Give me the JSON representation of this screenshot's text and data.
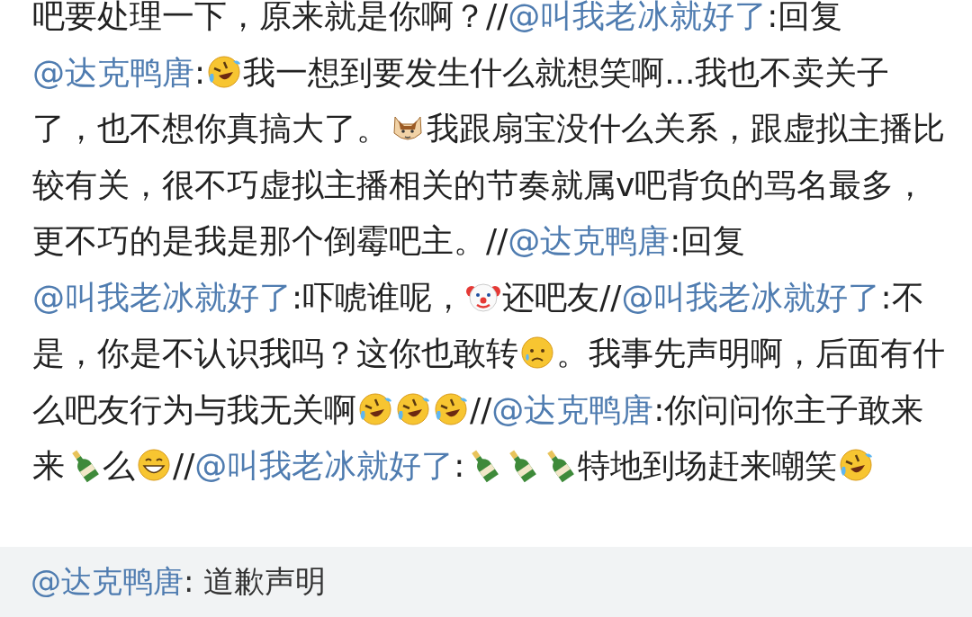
{
  "post": {
    "segments": [
      {
        "kind": "text",
        "text": "吧要处理一下，原来就是你啊？//"
      },
      {
        "kind": "mention",
        "text": "@叫我老冰就好了"
      },
      {
        "kind": "text",
        "text": ":回复"
      },
      {
        "kind": "mention",
        "text": "@达克鸭唐"
      },
      {
        "kind": "text",
        "text": ":"
      },
      {
        "kind": "laughing"
      },
      {
        "kind": "text",
        "text": "我一想到要发生什么就想笑啊...我也不卖关子了，也不想你真搞大了。"
      },
      {
        "kind": "cat"
      },
      {
        "kind": "text",
        "text": "我跟扇宝没什么关系，跟虚拟主播比较有关，很不巧虚拟主播相关的节奏就属v吧背负的骂名最多，更不巧的是我是那个倒霉吧主。//"
      },
      {
        "kind": "mention",
        "text": "@达克鸭唐"
      },
      {
        "kind": "text",
        "text": ":回复"
      },
      {
        "kind": "mention",
        "text": "@叫我老冰就好了"
      },
      {
        "kind": "text",
        "text": ":吓唬谁呢，"
      },
      {
        "kind": "clown"
      },
      {
        "kind": "text",
        "text": "还吧友//"
      },
      {
        "kind": "mention",
        "text": "@叫我老冰就好了"
      },
      {
        "kind": "text",
        "text": ":不是，你是不认识我吗？这你也敢转"
      },
      {
        "kind": "worried"
      },
      {
        "kind": "text",
        "text": "。我事先声明啊，后面有什么吧友行为与我无关啊"
      },
      {
        "kind": "laughing"
      },
      {
        "kind": "laughing"
      },
      {
        "kind": "laughing"
      },
      {
        "kind": "text",
        "text": "//"
      },
      {
        "kind": "mention",
        "text": "@达克鸭唐"
      },
      {
        "kind": "text",
        "text": ":你问问你主子敢来来"
      },
      {
        "kind": "champagne"
      },
      {
        "kind": "text",
        "text": "么"
      },
      {
        "kind": "grinning"
      },
      {
        "kind": "text",
        "text": "//"
      },
      {
        "kind": "mention",
        "text": "@叫我老冰就好了"
      },
      {
        "kind": "text",
        "text": ":"
      },
      {
        "kind": "champagne"
      },
      {
        "kind": "champagne"
      },
      {
        "kind": "champagne"
      },
      {
        "kind": "text",
        "text": "特地到场赶来嘲笑"
      },
      {
        "kind": "laughing"
      }
    ]
  },
  "origin": {
    "mention": "@达克鸭唐",
    "text": ": 道歉声明"
  }
}
